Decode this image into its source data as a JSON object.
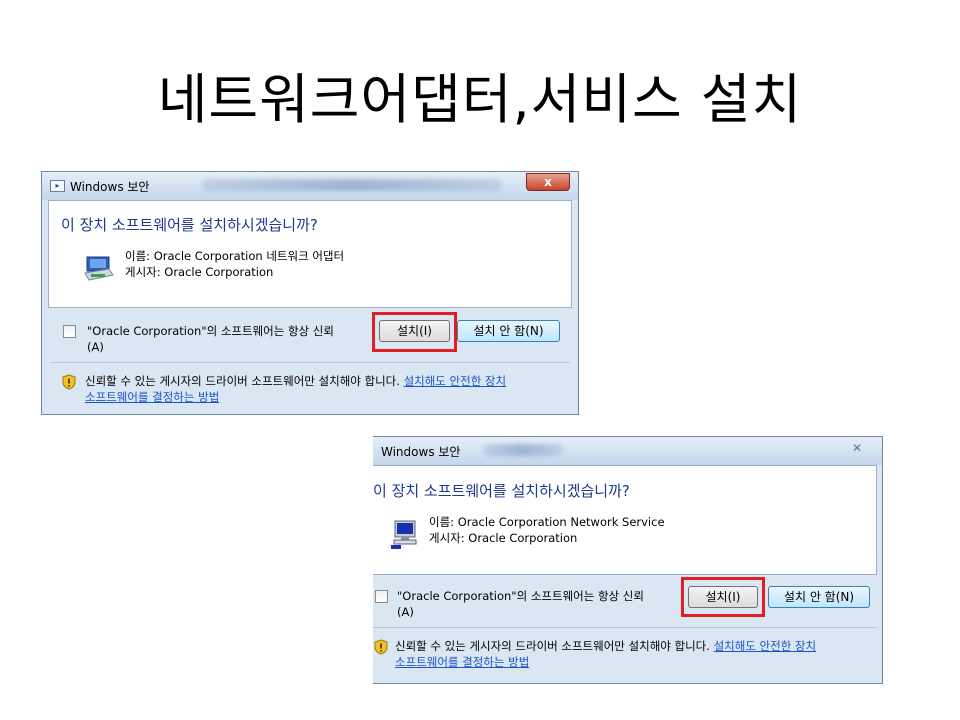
{
  "slide": {
    "title": "네트워크어댑터,서비스 설치"
  },
  "dialog1": {
    "window_title": "Windows 보안",
    "question": "이 장치 소프트웨어를 설치하시겠습니까?",
    "name_line": "이름: Oracle Corporation 네트워크 어댑터",
    "publisher_line": "게시자: Oracle Corporation",
    "trust_label_line1": "\"Oracle Corporation\"의 소프트웨어는 항상 신뢰",
    "trust_label_line2": "(A)",
    "install_button": "설치(I)",
    "dont_install_button": "설치 안 함(N)",
    "warning_text": "신뢰할 수 있는 게시자의 드라이버 소프트웨어만 설치해야 합니다.",
    "warning_link_part1": "설치해도 안전한 장치",
    "warning_link_part2": "소프트웨어를 결정하는 방법",
    "close_glyph": "x"
  },
  "dialog2": {
    "window_title": "Windows 보안",
    "question": "이 장치 소프트웨어를 설치하시겠습니까?",
    "name_line": "이름: Oracle Corporation Network Service",
    "publisher_line": "게시자: Oracle Corporation",
    "trust_label_line1": "\"Oracle Corporation\"의 소프트웨어는 항상 신뢰",
    "trust_label_line2": "(A)",
    "install_button": "설치(I)",
    "dont_install_button": "설치 안 함(N)",
    "warning_text": "신뢰할 수 있는 게시자의 드라이버 소프트웨어만 설치해야 합니다.",
    "warning_link_part1": "설치해도 안전한 장치",
    "warning_link_part2": "소프트웨어를 결정하는 방법",
    "close_glyph": "✕"
  },
  "colors": {
    "question_text": "#1e3a8e",
    "link": "#1a55c8",
    "highlight": "#e02020",
    "dialog_frame": "#dbe6f3"
  },
  "icons": [
    "network-adapter-icon",
    "network-service-icon",
    "shield-warning-icon",
    "window-app-icon",
    "close-icon"
  ]
}
